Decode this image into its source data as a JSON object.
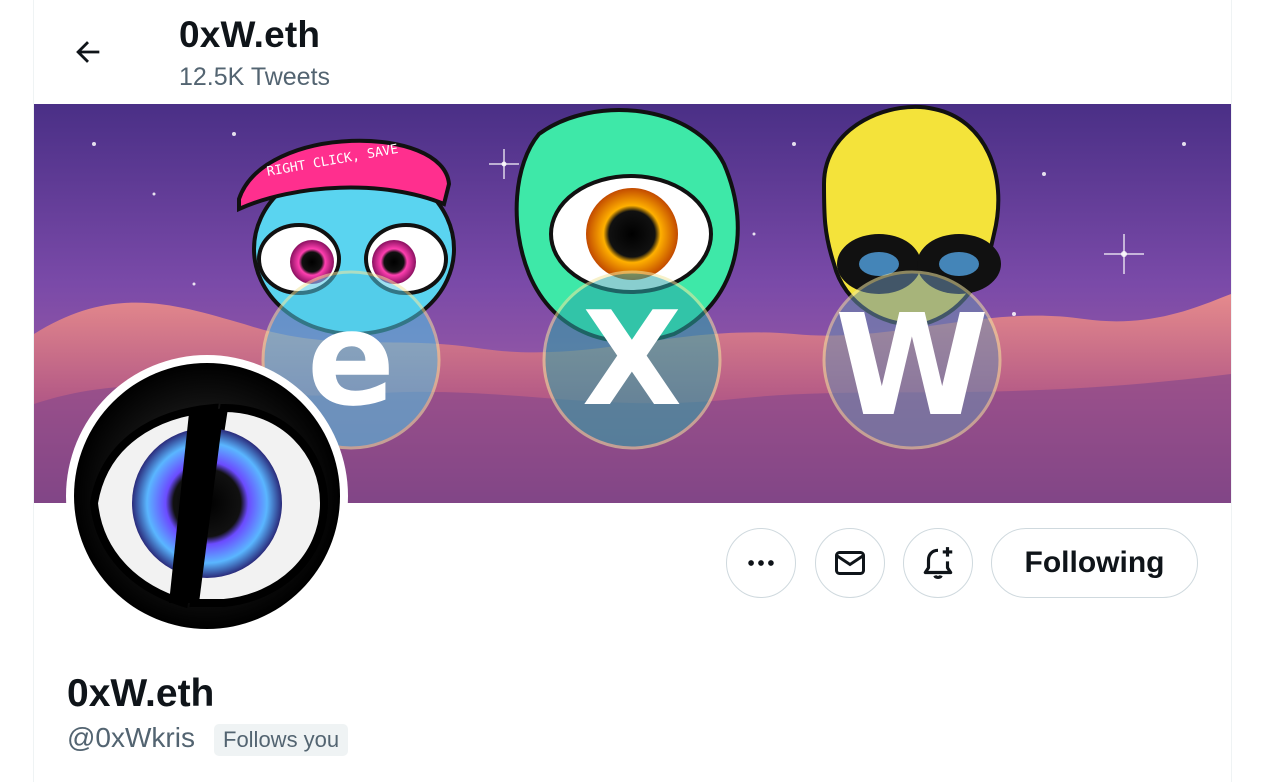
{
  "header": {
    "title": "0xW.eth",
    "tweet_count": "12.5K Tweets"
  },
  "banner": {
    "cap_text": "RIGHT CLICK, SAVE",
    "letters": [
      "e",
      "X",
      "W"
    ],
    "colors": {
      "sky": "#6a3f9a",
      "nebula": "#d97a8e",
      "alien_blue": "#5ad4f0",
      "alien_green": "#3ee8a8",
      "alien_yellow": "#f4e33a",
      "cap_pink": "#ff2f8e"
    }
  },
  "profile": {
    "display_name": "0xW.eth",
    "handle": "@0xWkris",
    "follows_you": "Follows you",
    "following_label": "Following"
  },
  "actions": {
    "more_icon": "more-icon",
    "message_icon": "envelope-icon",
    "notify_icon": "bell-plus-icon"
  }
}
